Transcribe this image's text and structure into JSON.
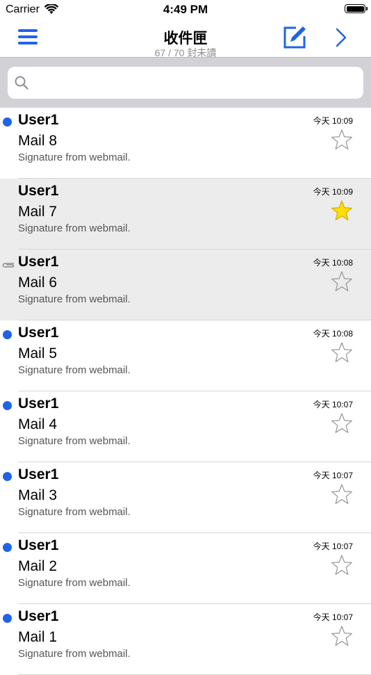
{
  "status_bar": {
    "carrier": "Carrier",
    "time": "4:49 PM"
  },
  "nav": {
    "title": "收件匣",
    "subtitle": "67 / 70 封未讀"
  },
  "search": {
    "placeholder": ""
  },
  "colors": {
    "accent": "#1f63e8",
    "unread_dot": "#1f63e8",
    "star_filled": "#ffde00",
    "star_empty": "#9b9b9b"
  },
  "mails": [
    {
      "sender": "User1",
      "subject": "Mail 8",
      "preview": "Signature from webmail.",
      "time": "今天 10:09",
      "unread": true,
      "starred": false,
      "attachment": false,
      "highlighted": false
    },
    {
      "sender": "User1",
      "subject": "Mail 7",
      "preview": "Signature from webmail.",
      "time": "今天 10:09",
      "unread": false,
      "starred": true,
      "attachment": false,
      "highlighted": true
    },
    {
      "sender": "User1",
      "subject": "Mail 6",
      "preview": "Signature from webmail.",
      "time": "今天 10:08",
      "unread": false,
      "starred": false,
      "attachment": true,
      "highlighted": true
    },
    {
      "sender": "User1",
      "subject": "Mail 5",
      "preview": "Signature from webmail.",
      "time": "今天 10:08",
      "unread": true,
      "starred": false,
      "attachment": false,
      "highlighted": false
    },
    {
      "sender": "User1",
      "subject": "Mail 4",
      "preview": "Signature from webmail.",
      "time": "今天 10:07",
      "unread": true,
      "starred": false,
      "attachment": false,
      "highlighted": false
    },
    {
      "sender": "User1",
      "subject": "Mail 3",
      "preview": "Signature from webmail.",
      "time": "今天 10:07",
      "unread": true,
      "starred": false,
      "attachment": false,
      "highlighted": false
    },
    {
      "sender": "User1",
      "subject": "Mail 2",
      "preview": "Signature from webmail.",
      "time": "今天 10:07",
      "unread": true,
      "starred": false,
      "attachment": false,
      "highlighted": false
    },
    {
      "sender": "User1",
      "subject": "Mail 1",
      "preview": "Signature from webmail.",
      "time": "今天 10:07",
      "unread": true,
      "starred": false,
      "attachment": false,
      "highlighted": false
    }
  ]
}
